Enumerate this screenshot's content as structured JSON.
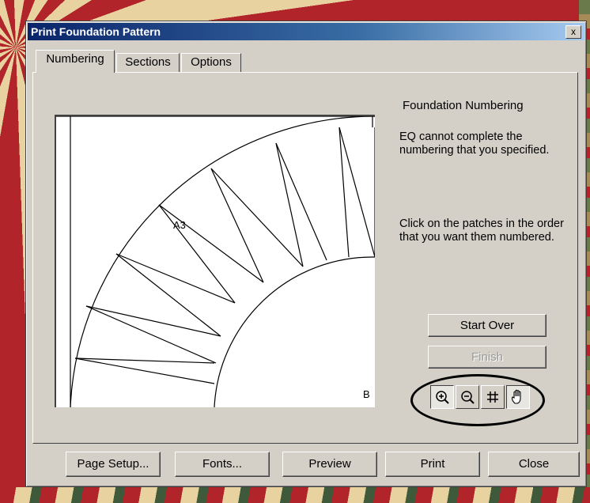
{
  "window": {
    "title": "Print Foundation Pattern",
    "close_label": "x"
  },
  "tabs": [
    {
      "label": "Numbering"
    },
    {
      "label": "Sections"
    },
    {
      "label": "Options"
    }
  ],
  "preview": {
    "patch_labels": [
      "A3",
      "B"
    ]
  },
  "panel": {
    "heading": "Foundation Numbering",
    "message": "EQ cannot complete the numbering that you specified.",
    "instruction": "Click on the patches in the order that you want them numbered."
  },
  "buttons": {
    "start_over": "Start Over",
    "finish": "Finish"
  },
  "tools": [
    "zoom-in-icon",
    "zoom-out-icon",
    "grid-icon",
    "hand-icon"
  ],
  "footer": {
    "page_setup": "Page Setup...",
    "fonts": "Fonts...",
    "preview": "Preview",
    "print": "Print",
    "close": "Close"
  }
}
